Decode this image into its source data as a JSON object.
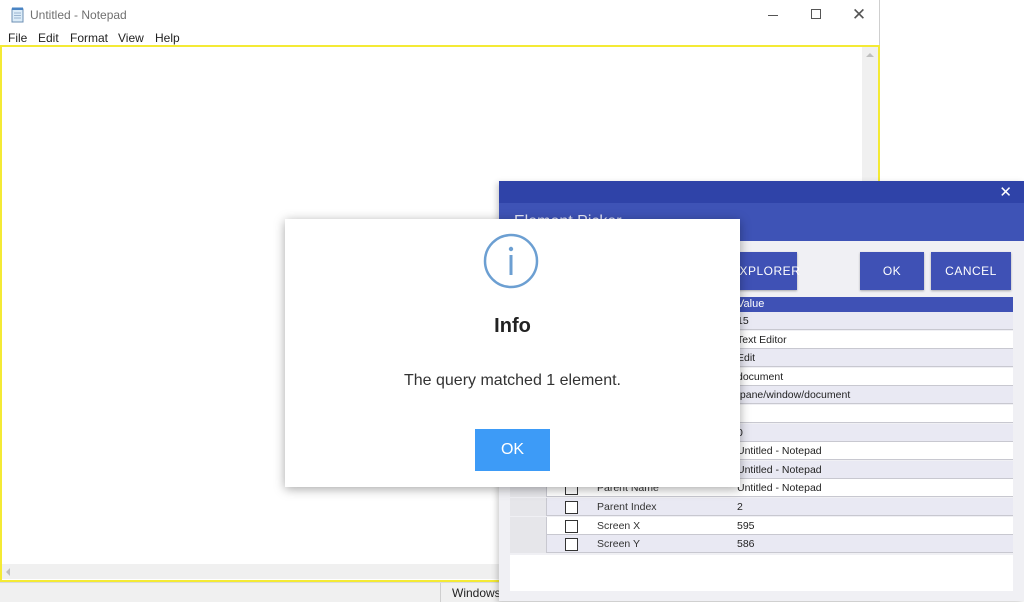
{
  "notepad": {
    "title": "Untitled - Notepad",
    "menu": [
      "File",
      "Edit",
      "Format",
      "View",
      "Help"
    ],
    "status_text": "Windows",
    "highlight_color": "#f4ea35",
    "icons": {
      "app": "notepad-icon",
      "minimize": "minimize-icon",
      "maximize": "maximize-icon",
      "close": "close-icon"
    },
    "close_glyph": "✕"
  },
  "picker": {
    "title": "Element Picker",
    "close_glyph": "✕",
    "buttons": {
      "explorer": "EXPLORER",
      "ok": "OK",
      "cancel": "CANCEL"
    },
    "table": {
      "value_header": "Value",
      "rows": [
        {
          "name": "",
          "value": "15"
        },
        {
          "name": "",
          "value": "Text Editor"
        },
        {
          "name": "",
          "value": "Edit"
        },
        {
          "name": "",
          "value": "document"
        },
        {
          "name": "",
          "value": "/pane/window/document"
        },
        {
          "name": "",
          "value": ""
        },
        {
          "name": "",
          "value": "0"
        },
        {
          "name": "",
          "value": "Untitled - Notepad"
        },
        {
          "name": "",
          "value": "Untitled - Notepad"
        },
        {
          "name": "Parent Name",
          "value": "Untitled - Notepad"
        },
        {
          "name": "Parent Index",
          "value": "2"
        },
        {
          "name": "Screen X",
          "value": "595"
        },
        {
          "name": "Screen Y",
          "value": "586"
        }
      ]
    },
    "accent_color": "#3f51b5"
  },
  "info_dialog": {
    "title": "Info",
    "message": "The query matched 1 element.",
    "ok_label": "OK",
    "icon": "info-icon",
    "accent_color": "#3d9bf7"
  }
}
